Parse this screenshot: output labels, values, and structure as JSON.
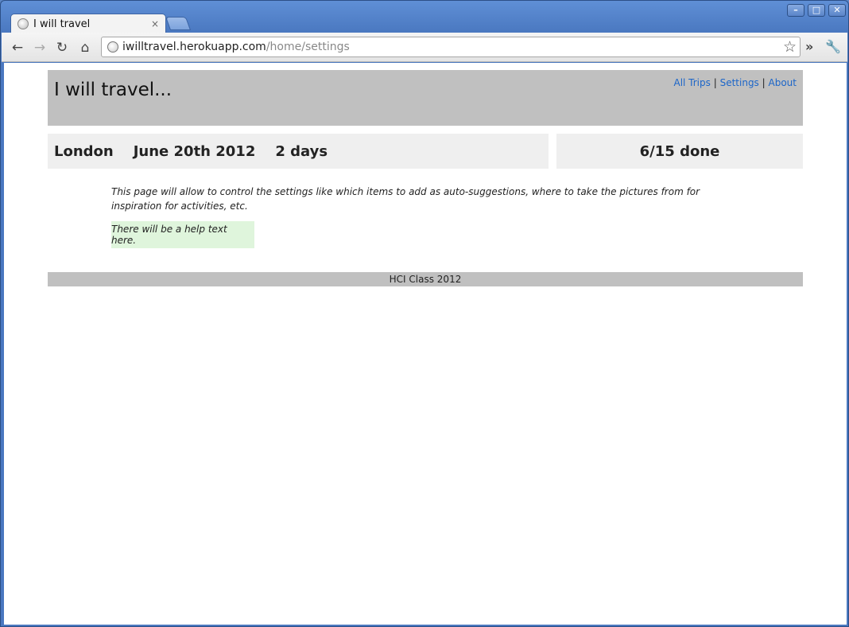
{
  "browser": {
    "tab_title": "I will travel",
    "tab_close": "×",
    "url_host": "iwilltravel.herokuapp.com",
    "url_path": "/home/settings",
    "icons": [
      "back-icon",
      "forward-icon",
      "reload-icon",
      "home-icon",
      "star-icon",
      "chevron-icon",
      "wrench-icon"
    ]
  },
  "header": {
    "title": "I will travel...",
    "nav": [
      {
        "label": "All Trips"
      },
      {
        "label": "Settings"
      },
      {
        "label": "About"
      }
    ],
    "separator": "|"
  },
  "trip": {
    "city": "London",
    "date": "June 20th 2012",
    "duration": "2 days",
    "progress": "6/15 done"
  },
  "content": {
    "description": "This page will allow to control the settings like which items to add as auto-suggestions, where to take the pictures from for inspiration for activities, etc.",
    "help_text": "There will be a help text here."
  },
  "footer": {
    "text": "HCI Class 2012"
  }
}
